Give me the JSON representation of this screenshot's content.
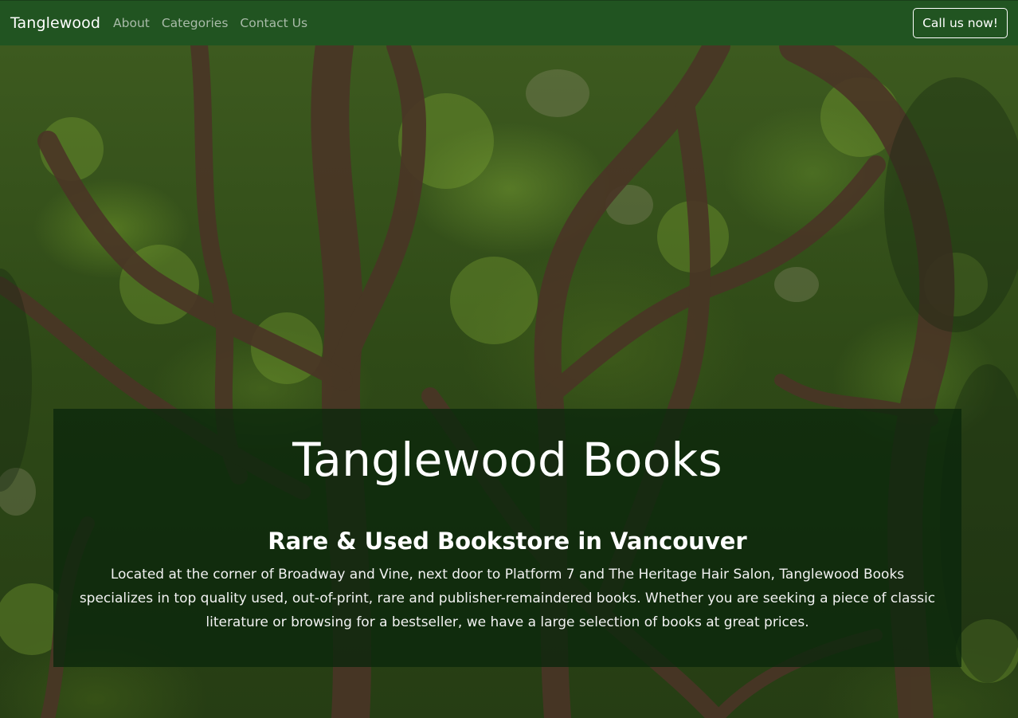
{
  "navbar": {
    "brand": "Tanglewood",
    "links": [
      "About",
      "Categories",
      "Contact Us"
    ],
    "cta_label": "Call us now!"
  },
  "hero": {
    "title": "Tanglewood Books",
    "subtitle": "Rare & Used Bookstore in Vancouver",
    "description": "Located at the corner of Broadway and Vine, next door to Platform 7 and The Heritage Hair Salon, Tanglewood Books specializes in top quality used, out-of-print, rare and publisher-remaindered books. Whether you are seeking a piece of classic literature or browsing for a bestseller, we have a large selection of books at great prices.",
    "background_image": "forest-canopy-photo"
  },
  "colors": {
    "navbar": "#215421",
    "panel": "#0a260c",
    "nav_link": "#a9bba9",
    "text": "#ffffff"
  }
}
